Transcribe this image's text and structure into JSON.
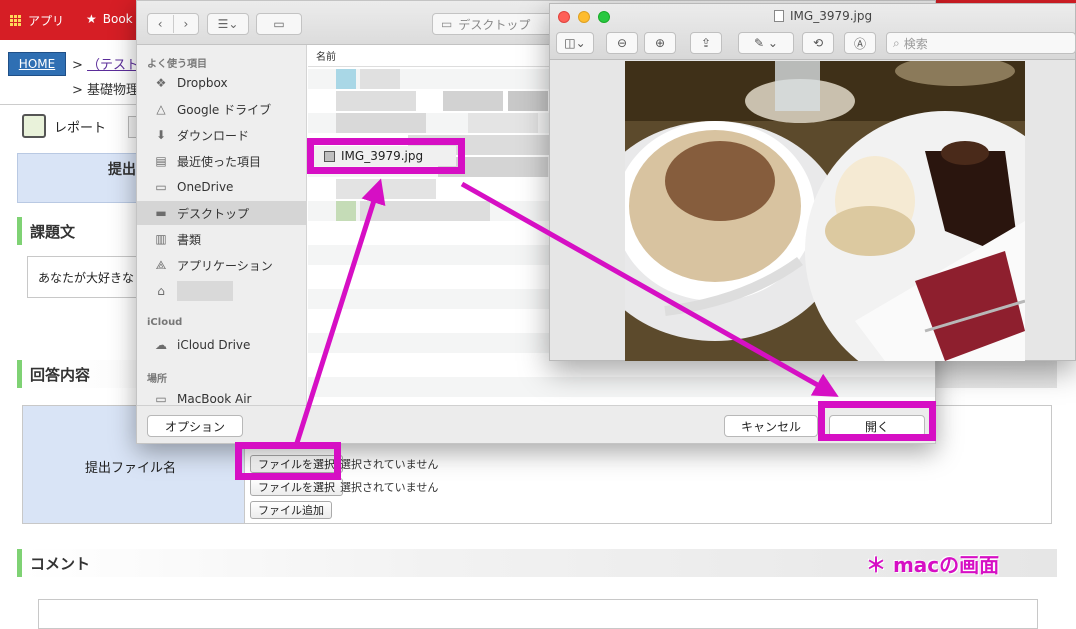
{
  "browser": {
    "bookmarks": [
      "アプリ",
      "Book"
    ]
  },
  "page": {
    "breadcrumb": {
      "home": "HOME",
      "course": "（テスト用",
      "sub": "基礎物理"
    },
    "report_label": "レポート",
    "submit_label": "提出",
    "task_heading": "課題文",
    "task_text": "あなたが大好きな",
    "answer_heading": "回答内容",
    "file_label": "提出ファイル名",
    "choose_file": "ファイルを選択",
    "no_file": "選択されていません",
    "add_file": "ファイル追加",
    "comment_heading": "コメント"
  },
  "finder": {
    "location": "デスクトップ",
    "sidebar_sections": {
      "favorites": "よく使う項目",
      "icloud": "iCloud",
      "places": "場所"
    },
    "favorites": [
      {
        "icon": "dropbox-icon",
        "label": "Dropbox"
      },
      {
        "icon": "google-drive-icon",
        "label": "Google ドライブ"
      },
      {
        "icon": "download-icon",
        "label": "ダウンロード"
      },
      {
        "icon": "recents-icon",
        "label": "最近使った項目"
      },
      {
        "icon": "folder-icon",
        "label": "OneDrive"
      },
      {
        "icon": "desktop-icon",
        "label": "デスクトップ",
        "selected": true
      },
      {
        "icon": "documents-icon",
        "label": "書類"
      },
      {
        "icon": "applications-icon",
        "label": "アプリケーション"
      },
      {
        "icon": "home-icon",
        "label": ""
      }
    ],
    "icloud_items": [
      {
        "icon": "cloud-icon",
        "label": "iCloud Drive"
      }
    ],
    "places_items": [
      {
        "icon": "drive-icon",
        "label": "MacBook Air"
      }
    ],
    "column_name": "名前",
    "selected_file": "IMG_3979.jpg",
    "options_button": "オプション",
    "cancel_button": "キャンセル",
    "open_button": "開く"
  },
  "preview": {
    "title": "IMG_3979.jpg",
    "search_placeholder": "検索"
  },
  "annotation": "＊ macの画面",
  "colors": {
    "highlight": "#d60fc4",
    "bookmark_bar": "#d61e25",
    "section_accent": "#7fd274"
  }
}
